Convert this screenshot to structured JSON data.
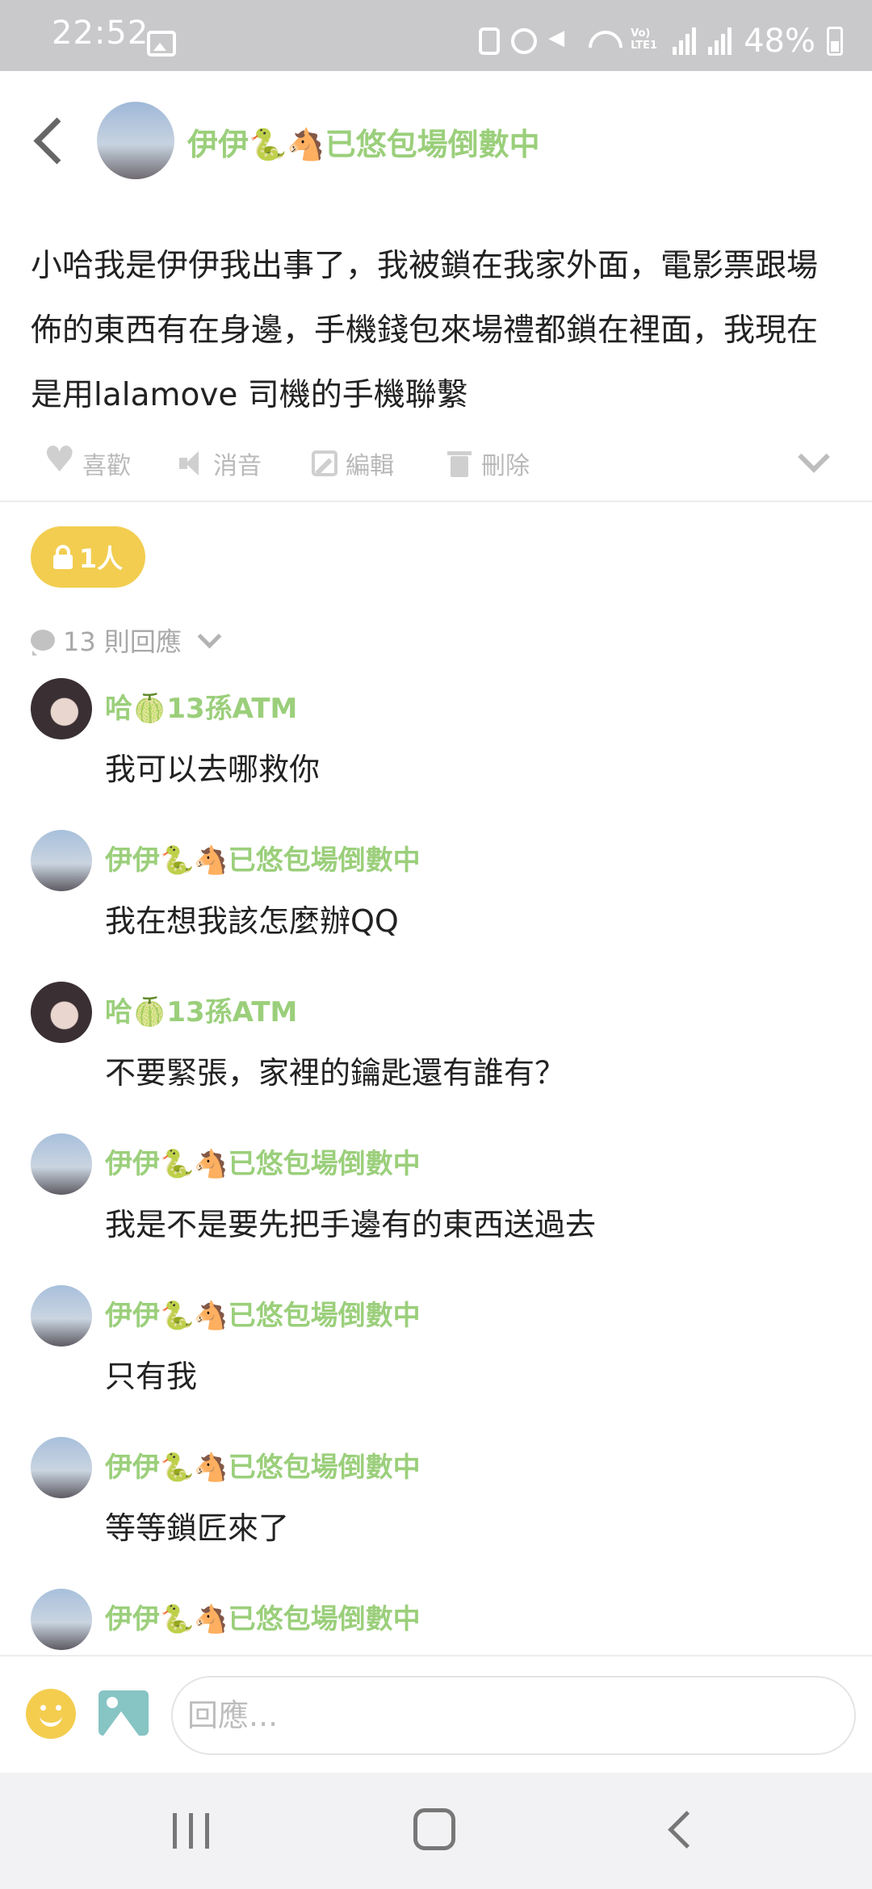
{
  "status_bar": {
    "time": "22:52",
    "battery": "48%",
    "network_label": "Vo) LTE1",
    "signal_label": "R"
  },
  "header": {
    "author": "伊伊🐍🐴已悠包場倒數中"
  },
  "post": {
    "text": "小哈我是伊伊我出事了，我被鎖在我家外面，電影票跟場佈的東西有在身邊，手機錢包來場禮都鎖在裡面，我現在是用lalamove 司機的手機聯繫"
  },
  "actions": {
    "like": "喜歡",
    "mute": "消音",
    "edit": "編輯",
    "delete": "刪除"
  },
  "privacy": {
    "badge": "1人"
  },
  "replies": {
    "count_label": "13 則回應"
  },
  "comments": [
    {
      "author": "哈🍈13孫ATM",
      "text": "我可以去哪救你",
      "avatar": "dark"
    },
    {
      "author": "伊伊🐍🐴已悠包場倒數中",
      "text": "我在想我該怎麼辦QQ",
      "avatar": "sky"
    },
    {
      "author": "哈🍈13孫ATM",
      "text": "不要緊張，家裡的鑰匙還有誰有？",
      "avatar": "dark"
    },
    {
      "author": "伊伊🐍🐴已悠包場倒數中",
      "text": "我是不是要先把手邊有的東西送過去",
      "avatar": "sky"
    },
    {
      "author": "伊伊🐍🐴已悠包場倒數中",
      "text": "只有我",
      "avatar": "sky"
    },
    {
      "author": "伊伊🐍🐴已悠包場倒數中",
      "text": "等等鎖匠來了",
      "avatar": "sky"
    },
    {
      "author": "伊伊🐍🐴已悠包場倒數中",
      "text": "",
      "avatar": "sky"
    }
  ],
  "composer": {
    "placeholder": "回應..."
  },
  "colors": {
    "accent_name": "#9bcf7b",
    "badge": "#f2cd50"
  }
}
